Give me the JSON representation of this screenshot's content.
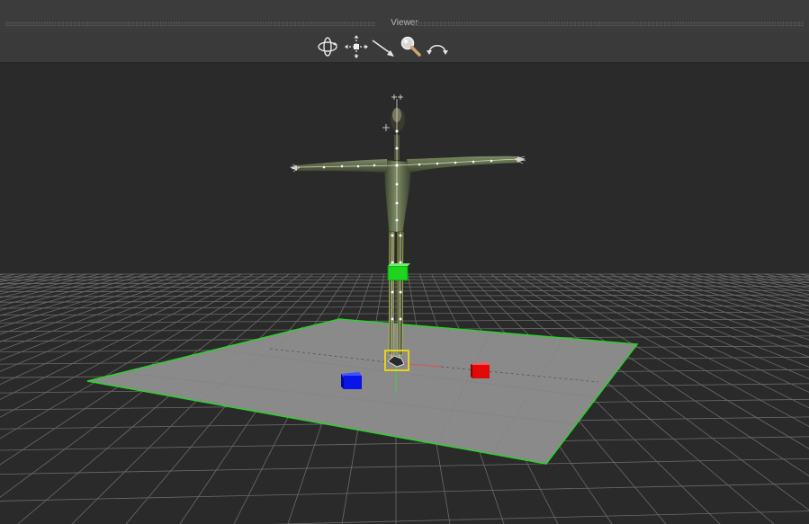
{
  "window": {
    "title": "Viewer"
  },
  "toolbar": {
    "tools": [
      {
        "name": "orbit",
        "icon": "orbit-icon"
      },
      {
        "name": "pan",
        "icon": "pan-arrows-icon"
      },
      {
        "name": "dolly",
        "icon": "dolly-arrow-icon"
      },
      {
        "name": "zoom",
        "icon": "magnifier-icon"
      },
      {
        "name": "rotate",
        "icon": "rotate-arc-icon"
      }
    ]
  },
  "scene": {
    "grid_color": "#6b6b6b",
    "ground_color": "#8a8a8a",
    "ground_outline_color": "#2cd12c",
    "x_axis_color": "#e05050",
    "z_axis_color": "#40d040",
    "markers": [
      {
        "name": "hip-effector",
        "color": "#1ed41e"
      },
      {
        "name": "left-marker",
        "color": "#0a14e6"
      },
      {
        "name": "right-marker",
        "color": "#e00a0a"
      },
      {
        "name": "root-selection",
        "color": "#e6d21e"
      }
    ],
    "figure_color": "#5a6447"
  }
}
